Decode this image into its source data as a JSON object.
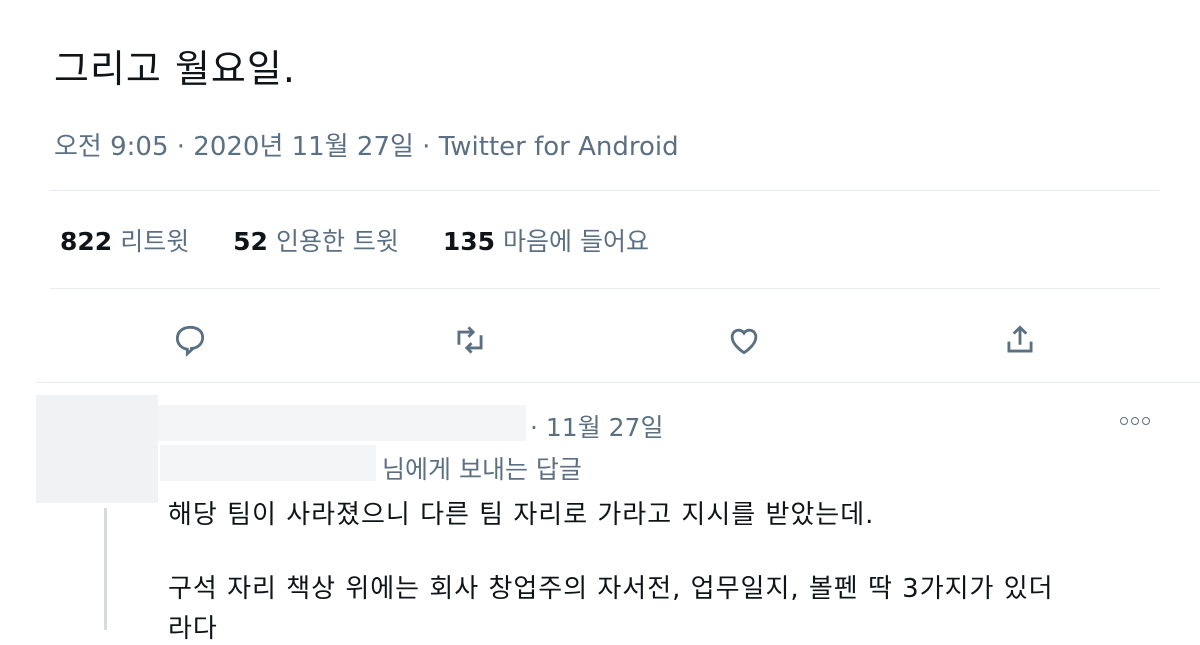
{
  "tweet": {
    "text": "그리고 월요일.",
    "meta": "오전 9:05 · 2020년 11월 27일 · Twitter for Android"
  },
  "stats": [
    {
      "count": "822",
      "label": "리트윗"
    },
    {
      "count": "52",
      "label": "인용한 트윗"
    },
    {
      "count": "135",
      "label": "마음에 들어요"
    }
  ],
  "actions": {
    "reply": "reply-icon",
    "retweet": "retweet-icon",
    "like": "heart-icon",
    "share": "share-icon"
  },
  "reply": {
    "time": "· 11월 27일",
    "reply_to": "님에게 보내는 답글",
    "lines": [
      "해당 팀이 사라졌으니 다른 팀 자리로 가라고 지시를 받았는데.",
      "구석 자리 책상 위에는 회사 창업주의 자서전, 업무일지, 볼펜 딱 3가지가 있더",
      "라다"
    ]
  },
  "colors": {
    "text": "#0f1419",
    "secondary": "#5b7083",
    "divider": "#e6ecf0"
  }
}
